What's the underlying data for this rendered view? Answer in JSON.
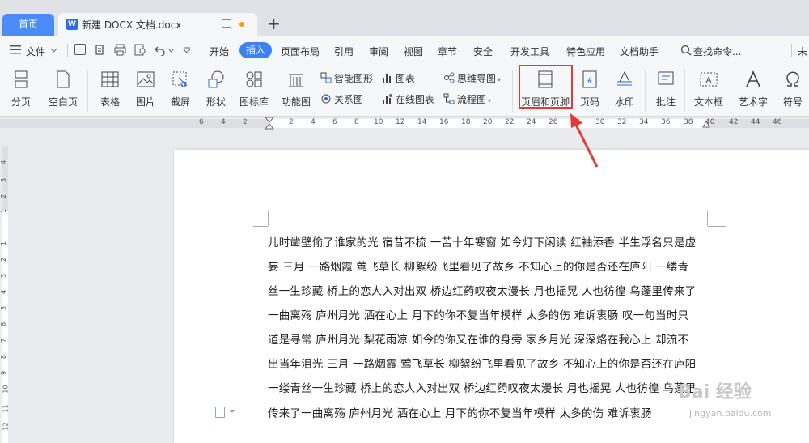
{
  "tabs": {
    "home": "首页",
    "document": "新建 DOCX 文档.docx",
    "new_tab": "+"
  },
  "menubar": {
    "file": "文件",
    "items": [
      "开始",
      "插入",
      "页面布局",
      "引用",
      "审阅",
      "视图",
      "章节",
      "安全",
      "开发工具",
      "特色应用",
      "文档助手"
    ],
    "active": "插入",
    "search": "查找命令...",
    "more": "未"
  },
  "ribbon": {
    "page_break": "分页",
    "blank_page": "空白页",
    "table": "表格",
    "picture": "图片",
    "screenshot": "截屏",
    "shape": "形状",
    "icon_library": "图标库",
    "function_chart": "功能图",
    "smart_graphic": "智能图形",
    "chart": "图表",
    "mind_map": "思维导图",
    "relation_chart": "关系图",
    "online_chart": "在线图表",
    "flowchart": "流程图",
    "header_footer": "页眉和页脚",
    "page_number": "页码",
    "watermark": "水印",
    "comment": "批注",
    "textbox": "文本框",
    "wordart": "艺术字",
    "symbol": "符号"
  },
  "ruler": {
    "top_ticks": [
      "6",
      "4",
      "2",
      "2",
      "4",
      "6",
      "8",
      "10",
      "12",
      "14",
      "16",
      "18",
      "20",
      "22",
      "24",
      "26",
      "28",
      "30",
      "32",
      "34",
      "36",
      "38",
      "40",
      "42",
      "44",
      "46"
    ],
    "left_ticks": [
      "4",
      "3",
      "2",
      "1",
      "1",
      "2",
      "3",
      "4",
      "5",
      "6",
      "7",
      "8",
      "9",
      "10",
      "11",
      "12"
    ]
  },
  "document": {
    "lines": [
      "儿时凿壁偷了谁家的光 宿昔不梳 一苦十年寒窗 如今灯下闲读 红袖添香 半生浮名只是虚",
      "妄 三月 一路烟霞 莺飞草长 柳絮纷飞里看见了故乡 不知心上的你是否还在庐阳 一缕青",
      "丝一生珍藏 桥上的恋人入对出双 桥边红药叹夜太漫长 月也摇晃 人也彷徨 乌蓬里传来了",
      "一曲离殇 庐州月光 洒在心上 月下的你不复当年模样 太多的伤 难诉衷肠 叹一句当时只",
      "道是寻常 庐州月光 梨花雨凉 如今的你又在谁的身旁 家乡月光 深深烙在我心上 却流不",
      "出当年泪光 三月 一路烟霞 莺飞草长 柳絮纷飞里看见了故乡 不知心上的你是否还在庐阳",
      "一缕青丝一生珍藏 桥上的恋人入对出双 桥边红药叹夜太漫长 月也摇晃 人也彷徨 乌蓬里",
      "传来了一曲离殇 庐州月光 洒在心上 月下的你不复当年模样 太多的伤 难诉衷肠"
    ]
  },
  "watermark": {
    "brand": "Bai 经验",
    "url": "jingyan.baidu.com"
  },
  "colors": {
    "accent": "#3b82f6",
    "highlight": "#e53935",
    "home_tab": "#4a8cf7"
  }
}
